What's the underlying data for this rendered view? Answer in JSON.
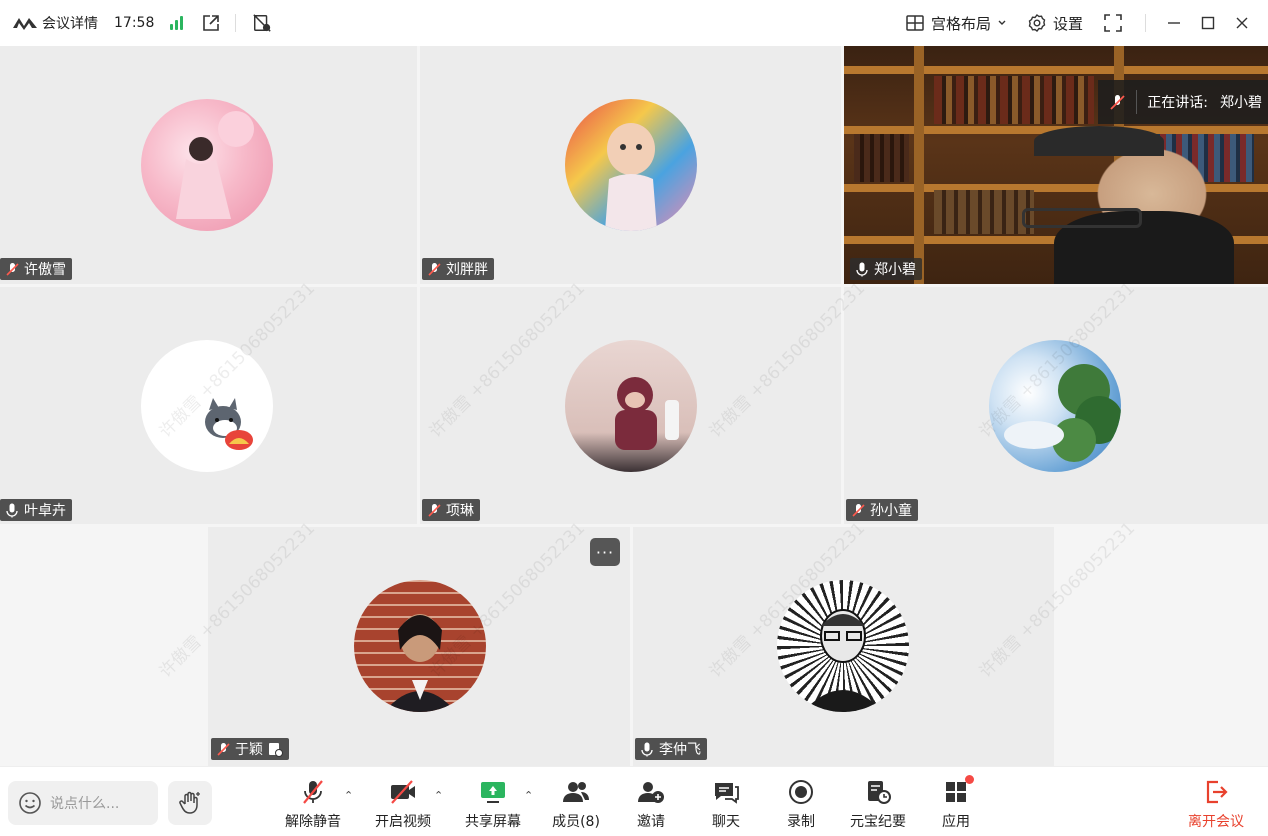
{
  "titlebar": {
    "title": "会议详情",
    "time": "17:58",
    "layout_label": "宫格布局",
    "settings_label": "设置"
  },
  "watermark_text": "许傲雪 +8615068052231",
  "participants": [
    {
      "name": "许傲雪",
      "mic": "muted",
      "avatar": "pink-girl-avatar"
    },
    {
      "name": "刘胖胖",
      "mic": "muted",
      "avatar": "baby-avatar"
    },
    {
      "name": "郑小碧",
      "mic": "on",
      "avatar": "video-feed"
    },
    {
      "name": "叶卓卉",
      "mic": "on",
      "avatar": "husky-cartoon-avatar"
    },
    {
      "name": "项琳",
      "mic": "muted",
      "avatar": "cat-sweater-avatar"
    },
    {
      "name": "孙小童",
      "mic": "muted",
      "avatar": "sky-tree-avatar"
    },
    {
      "name": "于颖",
      "mic": "muted",
      "avatar": "woman-brick-wall-avatar"
    },
    {
      "name": "李仲飞",
      "mic": "on",
      "avatar": "man-sketch-avatar"
    }
  ],
  "speaking": {
    "label": "正在讲话:",
    "name": "郑小碧"
  },
  "more_label": "···",
  "toolbar": {
    "chat_placeholder": "说点什么...",
    "unmute": "解除静音",
    "start_video": "开启视频",
    "share_screen": "共享屏幕",
    "members": "成员(8)",
    "invite": "邀请",
    "chat": "聊天",
    "record": "录制",
    "minutes": "元宝纪要",
    "apps": "应用",
    "leave": "离开会议"
  },
  "colors": {
    "accent_green": "#2bb55f",
    "speaker_outline": "#36c47d",
    "leave_red": "#e8412d"
  }
}
